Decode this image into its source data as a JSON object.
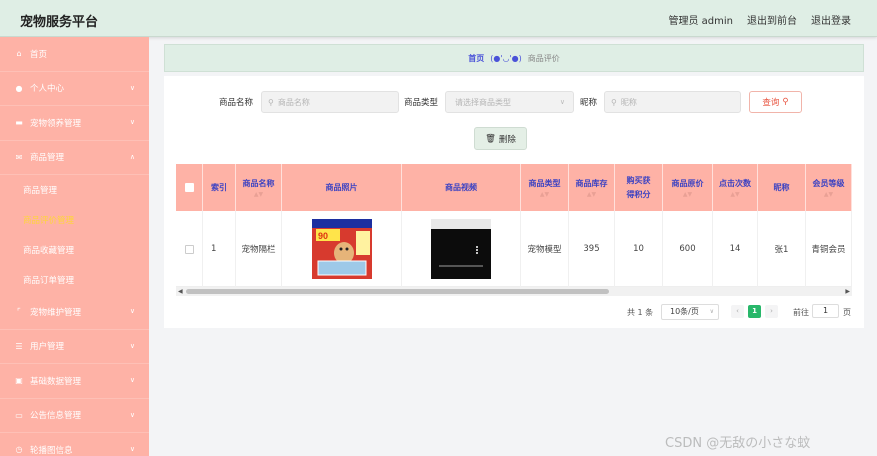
{
  "app": {
    "title": "宠物服务平台"
  },
  "header": {
    "user": "管理员 admin",
    "front": "退出到前台",
    "logout": "退出登录"
  },
  "sidebar": {
    "home": "首页",
    "personal": "个人中心",
    "pet_service": "宠物领养管理",
    "goods": "商品管理",
    "sub": [
      "商品管理",
      "商品评价管理",
      "商品收藏管理",
      "商品订单管理"
    ],
    "pet_care": "宠物维护管理",
    "users": "用户管理",
    "base_data": "基础数据管理",
    "notice": "公告信息管理",
    "carousel": "轮播图信息"
  },
  "breadcrumb": {
    "home": "首页",
    "emoticon": "(●'◡'●)",
    "current": "商品评价"
  },
  "search": {
    "name_label": "商品名称",
    "name_placeholder": "商品名称",
    "type_label": "商品类型",
    "type_placeholder": "请选择商品类型",
    "nick_label": "昵称",
    "nick_placeholder": "昵称",
    "query_btn": "查询"
  },
  "delete_btn": "删除",
  "table": {
    "headers": [
      "索引",
      "商品名称",
      "商品照片",
      "商品视频",
      "商品类型",
      "商品库存",
      "购买获得积分",
      "商品原价",
      "点击次数",
      "昵称",
      "会员等级"
    ],
    "row": {
      "index": "1",
      "name": "宠物隔栏",
      "type": "宠物模型",
      "stock": "395",
      "points": "10",
      "price": "600",
      "clicks": "14",
      "nick": "张1",
      "level": "青铜会员"
    },
    "photo_badge": "90"
  },
  "pager": {
    "total": "共 1 条",
    "size": "10条/页",
    "current": "1",
    "goto": "前往",
    "page_input": "1",
    "page_unit": "页"
  },
  "watermark": "CSDN @无敌の小さな蚊"
}
